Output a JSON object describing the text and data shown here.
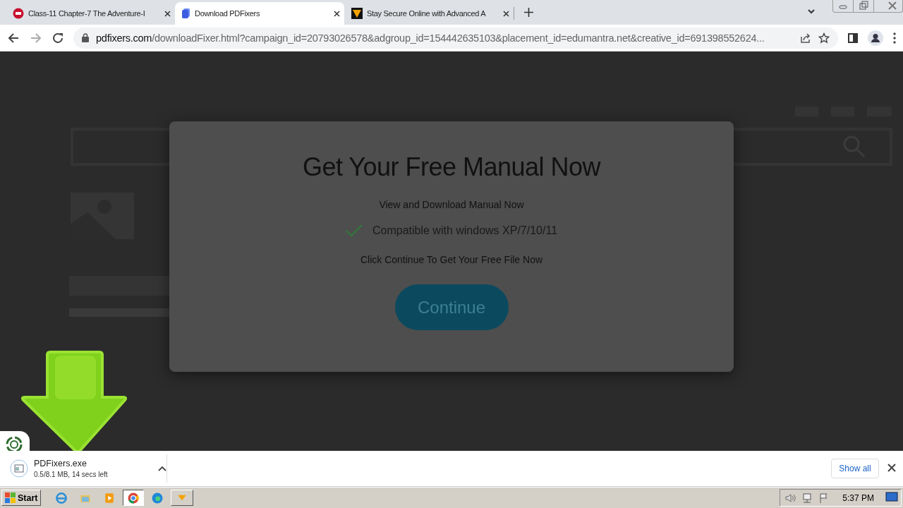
{
  "tabs": [
    {
      "title": "Class-11 Chapter-7 The Adventure-I",
      "selected": false
    },
    {
      "title": "Download PDFixers",
      "selected": true
    },
    {
      "title": "Stay Secure Online with Advanced A",
      "selected": false
    }
  ],
  "address_bar": {
    "domain": "pdfixers.com",
    "path": "/downloadFixer.html?campaign_id=20793026578&adgroup_id=154442635103&placement_id=edumantra.net&creative_id=691398552624..."
  },
  "dialog": {
    "title": "Get Your Free Manual Now",
    "subtitle": "View and Download Manual Now",
    "feature": "Compatible with windows XP/7/10/11",
    "instruction": "Click Continue To Get Your Free File Now",
    "button": "Continue"
  },
  "download": {
    "file_name": "PDFixers.exe",
    "progress": "0.5/8.1 MB, 14 secs left",
    "show_all": "Show all"
  },
  "taskbar": {
    "start": "Start",
    "apps": [
      {
        "kind": "ie",
        "selected": false
      },
      {
        "kind": "folder",
        "selected": false
      },
      {
        "kind": "media",
        "selected": false
      },
      {
        "kind": "chrome",
        "selected": true
      },
      {
        "kind": "edge",
        "selected": false
      },
      {
        "kind": "arrow",
        "selected": false
      }
    ],
    "clock": "5:37 PM"
  }
}
